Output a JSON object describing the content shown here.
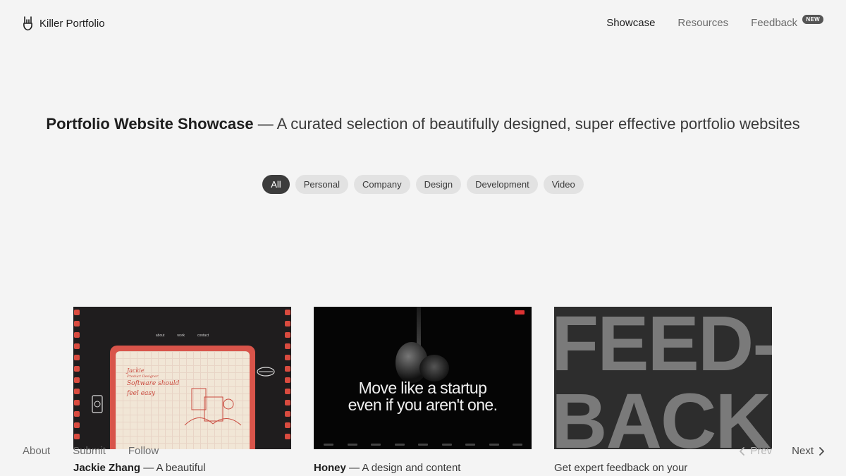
{
  "brand": {
    "name": "Killer Portfolio",
    "icon": "rock-hand-icon"
  },
  "nav": {
    "showcase": "Showcase",
    "resources": "Resources",
    "feedback": "Feedback",
    "feedback_badge": "NEW"
  },
  "hero": {
    "title_bold": "Portfolio Website Showcase",
    "title_rest": " — A curated selection of beautifully designed, super effective portfolio websites"
  },
  "filters": [
    "All",
    "Personal",
    "Company",
    "Design",
    "Development",
    "Video"
  ],
  "active_filter": "All",
  "cards": [
    {
      "name": "Jackie Zhang",
      "desc": " — A beautiful",
      "thumb": {
        "nav": [
          "about",
          "work",
          "contact"
        ],
        "line1": "Jackie",
        "line2": "Product Designer",
        "line3": "Software should",
        "line4": "feel easy"
      }
    },
    {
      "name": "Honey",
      "desc": " — A design and content",
      "thumb": {
        "headline1": "Move like a startup",
        "headline2": "even if you aren't one."
      }
    },
    {
      "name": "",
      "desc": "Get expert feedback on your",
      "thumb": {
        "line1": "FEED-",
        "line2": "BACK"
      }
    }
  ],
  "footer": {
    "about": "About",
    "submit": "Submit",
    "follow": "Follow",
    "prev": "Prev",
    "next": "Next"
  },
  "colors": {
    "accent_dark": "#3c3c3c",
    "chip_bg": "#e2e2e2",
    "card_red": "#d8544a",
    "page_bg": "#f4f4f4"
  }
}
